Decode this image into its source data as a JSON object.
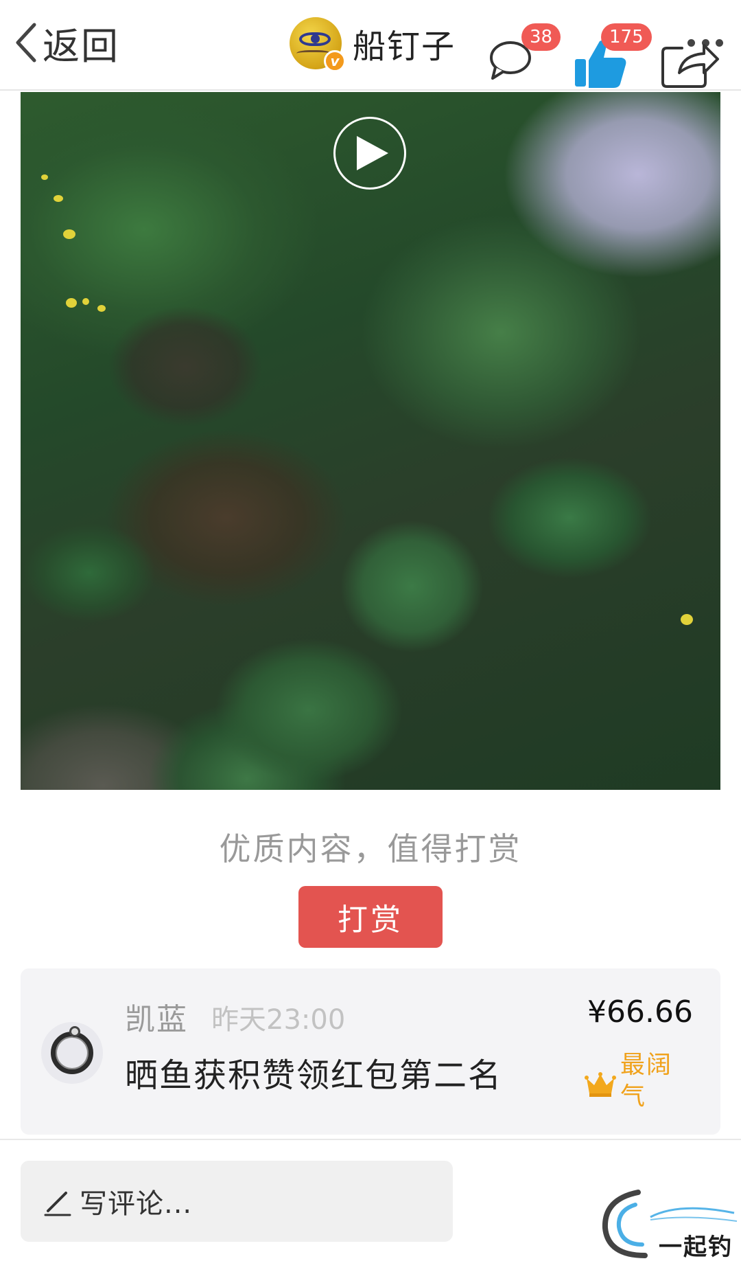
{
  "nav": {
    "back_label": "返回",
    "author_name": "船钉子"
  },
  "video": {
    "state": "paused"
  },
  "reward": {
    "prompt": "优质内容，值得打赏",
    "button_label": "打赏"
  },
  "reward_record": {
    "user": "凯蓝",
    "time": "昨天23:00",
    "message": "晒鱼获积赞领红包第二名",
    "amount": "¥66.66",
    "tag": "最阔气"
  },
  "bottom_bar": {
    "comment_placeholder": "写评论...",
    "comment_count": "38",
    "like_count": "175"
  },
  "watermark": {
    "text": "一起钓鱼"
  },
  "colors": {
    "reward_button": "#e35450",
    "badge": "#f05a55",
    "tag": "#f0a21c",
    "like_icon": "#1e9be0"
  }
}
